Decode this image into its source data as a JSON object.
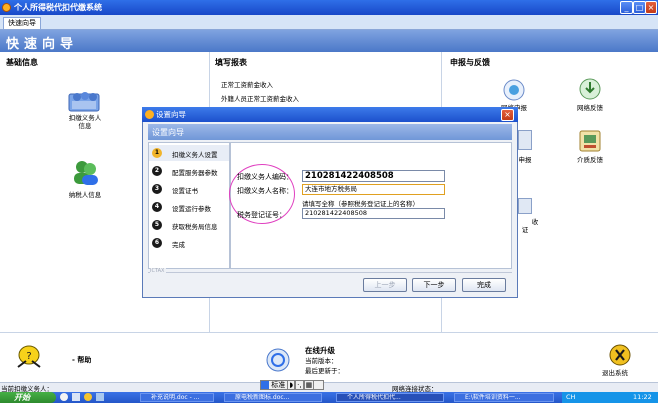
{
  "window": {
    "title": "个人所得税代扣代缴系统",
    "controls": [
      "_",
      "□",
      "×"
    ]
  },
  "tab": {
    "label": "快速向导"
  },
  "header": {
    "title": "快速向导"
  },
  "sections": {
    "basic": {
      "title": "基础信息",
      "items": [
        {
          "label": "扣缴义务人\n信息",
          "icon": "people-folder-icon"
        },
        {
          "label": "纳税人信息",
          "icon": "users-icon"
        }
      ]
    },
    "report": {
      "title": "填写报表",
      "items": [
        "正常工资薪金收入",
        "外籍人员正常工资薪金收入"
      ]
    },
    "declare": {
      "title": "申报与反馈",
      "items": [
        {
          "label": "网络申报",
          "icon": "network-declare-icon"
        },
        {
          "label": "网络反馈",
          "icon": "network-feedback-icon"
        },
        {
          "label": "申报",
          "icon": "declare-icon"
        },
        {
          "label": "介质反馈",
          "icon": "media-feedback-icon"
        },
        {
          "label": "收",
          "icon": "collect-icon"
        },
        {
          "label": "证",
          "icon": "certificate-icon"
        }
      ]
    }
  },
  "bottom": {
    "help": "帮助",
    "upgrade_title": "在线升级",
    "current_version_label": "当前版本：",
    "last_update_label": "最后更新于：",
    "exit": "退出系统"
  },
  "status": {
    "agent_label": "当前扣缴义务人：",
    "network_label": "网络连接状态："
  },
  "ime": {
    "text": "标准"
  },
  "taskbar": {
    "start": "开始",
    "tasks": [
      "补充说明.doc - ...",
      "原电税新图标.doc...",
      "个人所得税代扣代...",
      "E:\\软件培训资料一..."
    ],
    "lang": "CH",
    "clock": "11:22"
  },
  "dialog": {
    "title": "设置向导",
    "heading": "设置向导",
    "steps": [
      {
        "num": "1",
        "label": "扣缴义务人设置"
      },
      {
        "num": "2",
        "label": "配置服务器参数"
      },
      {
        "num": "3",
        "label": "设置证书"
      },
      {
        "num": "4",
        "label": "设置运行参数"
      },
      {
        "num": "5",
        "label": "获取税务局信息"
      },
      {
        "num": "6",
        "label": "完成"
      }
    ],
    "active_step": 1,
    "fields": {
      "code_label": "扣缴义务人编码：",
      "code_value": "210281422408508",
      "name_label": "扣缴义务人名称：",
      "name_value": "大连市地方税务局",
      "hint": "请填写全称（参照税务登记证上的名称）",
      "reg_label": "税务登记证号：",
      "reg_value": "210281422408508"
    },
    "footer_brand": "ICTAX",
    "buttons": {
      "prev": "上一步",
      "next": "下一步",
      "finish": "完成"
    }
  }
}
